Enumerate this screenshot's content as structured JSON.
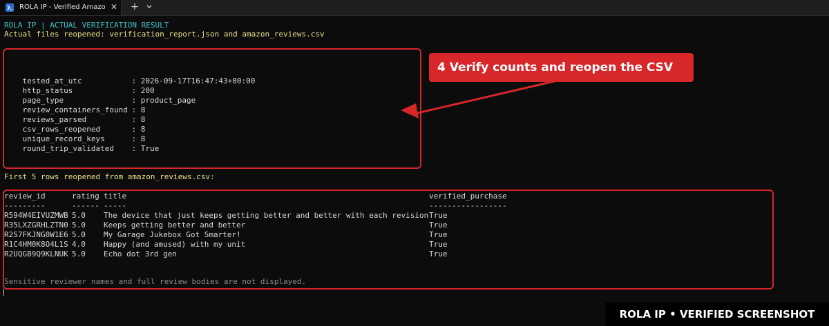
{
  "window": {
    "tab_title": "ROLA IP - Verified Amazon Re",
    "tab_icon": "powershell-icon",
    "close_glyph": "✕",
    "new_tab_glyph": "+"
  },
  "terminal": {
    "header_line": "ROLA IP | ACTUAL VERIFICATION RESULT",
    "reopened_line": "Actual files reopened: verification_report.json and amazon_reviews.csv",
    "report": [
      {
        "key": "tested_at_utc",
        "sep": ": ",
        "value": "2026-09-17T16:47:43+00:00"
      },
      {
        "key": "http_status",
        "sep": ": ",
        "value": "200"
      },
      {
        "key": "page_type",
        "sep": ": ",
        "value": "product_page"
      },
      {
        "key": "review_containers_found",
        "sep": ": ",
        "value": "8"
      },
      {
        "key": "reviews_parsed",
        "sep": ": ",
        "value": "8"
      },
      {
        "key": "csv_rows_reopened",
        "sep": ": ",
        "value": "8"
      },
      {
        "key": "unique_record_keys",
        "sep": ": ",
        "value": "8"
      },
      {
        "key": "round_trip_validated",
        "sep": ": ",
        "value": "True"
      }
    ],
    "rows_heading": "First 5 rows reopened from amazon_reviews.csv:",
    "table": {
      "headers": [
        "review_id",
        "rating",
        "title",
        "verified_purchase"
      ],
      "underlines": [
        "---------",
        "------",
        "-----",
        "-----------------"
      ],
      "rows": [
        [
          "R594W4EIVUZMWB",
          "5.0",
          "The device that just keeps getting better and better with each revision",
          "True"
        ],
        [
          "R35LXZGRHLZTN0",
          "5.0",
          "Keeps getting better and better",
          "True"
        ],
        [
          "R2S7FKJNG0W1E6",
          "5.0",
          "My Garage Jukebox Got Smarter!",
          "True"
        ],
        [
          "R1C4HM0K8O4L1S",
          "4.0",
          "Happy (and amused) with my unit",
          "True"
        ],
        [
          "R2UQGB9Q9KLNUK",
          "5.0",
          "Echo dot 3rd gen",
          "True"
        ]
      ]
    },
    "footer_note": "Sensitive reviewer names and full review bodies are not displayed."
  },
  "annotation": {
    "callout_text": "4  Verify counts and reopen the CSV",
    "accent_color": "#d8272b"
  },
  "badge": {
    "text": "ROLA IP  •  VERIFIED SCREENSHOT"
  }
}
